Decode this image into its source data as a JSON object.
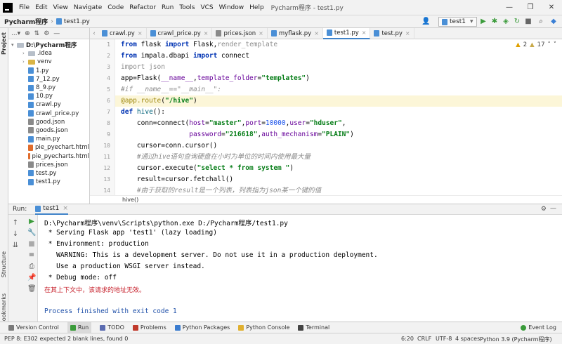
{
  "window": {
    "menu": [
      "File",
      "Edit",
      "View",
      "Navigate",
      "Code",
      "Refactor",
      "Run",
      "Tools",
      "VCS",
      "Window",
      "Help"
    ],
    "title": "Pycharm程序 - test1.py",
    "minimize": "—",
    "maximize": "❐",
    "close": "✕"
  },
  "navbar": {
    "project": "Pycharm程序",
    "file": "test1.py",
    "run_config": "test1"
  },
  "project_pane": {
    "label": "Project",
    "items": [
      {
        "label": "D:\\Pycharm程序",
        "kind": "root"
      },
      {
        "label": ".idea",
        "kind": "folder"
      },
      {
        "label": "venv",
        "kind": "venv"
      },
      {
        "label": "1.py",
        "kind": "py"
      },
      {
        "label": "7_12.py",
        "kind": "py"
      },
      {
        "label": "8_9.py",
        "kind": "py"
      },
      {
        "label": "10.py",
        "kind": "py"
      },
      {
        "label": "crawl.py",
        "kind": "py"
      },
      {
        "label": "crawl_price.py",
        "kind": "py"
      },
      {
        "label": "good.json",
        "kind": "json"
      },
      {
        "label": "goods.json",
        "kind": "json"
      },
      {
        "label": "main.py",
        "kind": "py"
      },
      {
        "label": "pie_pyechart.html",
        "kind": "html"
      },
      {
        "label": "pie_pyecharts.html",
        "kind": "html"
      },
      {
        "label": "prices.json",
        "kind": "json"
      },
      {
        "label": "test.py",
        "kind": "py"
      },
      {
        "label": "test1.py",
        "kind": "py"
      }
    ]
  },
  "tabs": [
    {
      "label": "crawl.py",
      "kind": "py"
    },
    {
      "label": "crawl_price.py",
      "kind": "py"
    },
    {
      "label": "prices.json",
      "kind": "json"
    },
    {
      "label": "myflask.py",
      "kind": "py"
    },
    {
      "label": "test1.py",
      "kind": "py",
      "active": true
    },
    {
      "label": "test.py",
      "kind": "py"
    }
  ],
  "editor": {
    "warnings": "2",
    "weak_warnings": "17",
    "breadcrumb": "hive()",
    "line_numbers": [
      "1",
      "2",
      "3",
      "4",
      "5",
      "6",
      "7",
      "8",
      "9",
      "10",
      "11",
      "12",
      "13",
      "14"
    ]
  },
  "run_panel": {
    "label": "Run:",
    "tab": "test1",
    "output": [
      {
        "text": "D:\\Pycharm程序\\venv\\Scripts\\python.exe D:/Pycharm程序/test1.py",
        "style": "normal"
      },
      {
        "text": " * Serving Flask app 'test1' (lazy loading)",
        "style": "normal"
      },
      {
        "text": " * Environment: production",
        "style": "normal"
      },
      {
        "text": "   WARNING: This is a development server. Do not use it in a production deployment.",
        "style": "normal"
      },
      {
        "text": "   Use a production WSGI server instead.",
        "style": "normal"
      },
      {
        "text": " * Debug mode: off",
        "style": "normal"
      },
      {
        "text": "在其上下文中，该请求的地址无效。",
        "style": "red"
      },
      {
        "text": "",
        "style": "normal"
      },
      {
        "text": "Process finished with exit code 1",
        "style": "blue"
      }
    ]
  },
  "tool_windows": [
    "Version Control",
    "Run",
    "TODO",
    "Problems",
    "Python Packages",
    "Python Console",
    "Terminal"
  ],
  "left_stripe": [
    "Structure",
    "Bookmarks"
  ],
  "status": {
    "message": "PEP 8: E302 expected 2 blank lines, found 0",
    "position": "6:20",
    "line_sep": "CRLF",
    "encoding": "UTF-8",
    "indent": "4 spaces",
    "interpreter": "Python 3.9 (Pycharm程序)",
    "event_log": "Event Log"
  }
}
